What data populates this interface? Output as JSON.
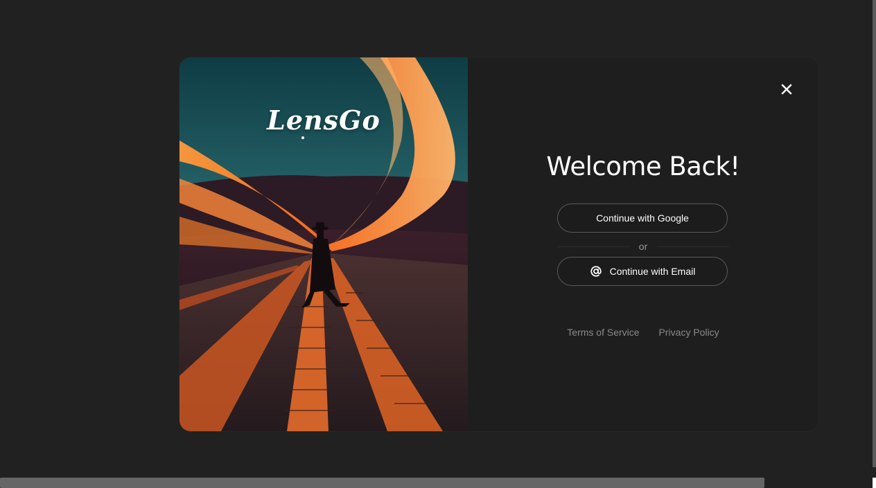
{
  "modal": {
    "logo_text": "LensGo",
    "title": "Welcome Back!",
    "google_button": "Continue with Google",
    "divider_text": "or",
    "email_button": "Continue with Email",
    "terms_link": "Terms of Service",
    "privacy_link": "Privacy Policy",
    "close_icon": "close-icon",
    "email_icon": "at-sign-icon"
  },
  "colors": {
    "page_background": "#212121",
    "modal_background": "#1e1e1e",
    "button_border": "#5a5a5a",
    "accent_orange": "#f07a2a"
  }
}
